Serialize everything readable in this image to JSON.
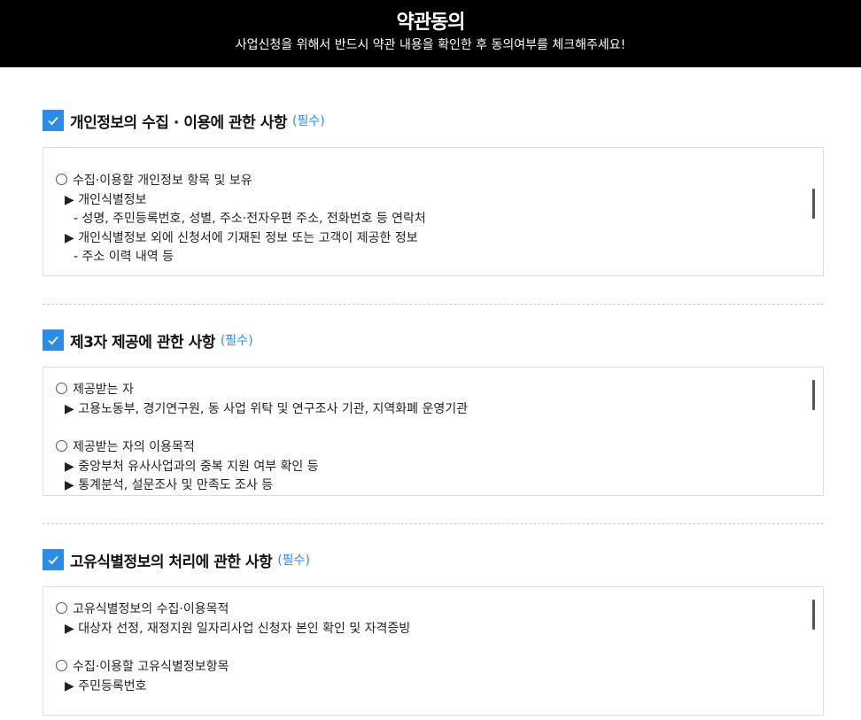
{
  "header": {
    "title": "약관동의",
    "subtitle": "사업신청을 위해서 반드시 약관 내용을 확인한 후 동의여부를 체크해주세요!"
  },
  "sections": [
    {
      "title": "개인정보의 수집 · 이용에 관한 사항",
      "required": "(필수)",
      "checked": true,
      "lines": [
        "수집·이용할 개인정보 항목 및 보유",
        "▶ 개인식별정보",
        "- 성명, 주민등록번호, 성별, 주소·전자우편 주소, 전화번호 등 연락처",
        "▶ 개인식별정보 외에 신청서에 기재된 정보 또는 고객이 제공한 정보",
        "- 주소 이력 내역 등"
      ]
    },
    {
      "title": "제3자 제공에 관한 사항",
      "required": "(필수)",
      "checked": true,
      "lines": [
        "제공받는 자",
        "▶ 고용노동부, 경기연구원, 동 사업 위탁 및 연구조사 기관, 지역화폐 운영기관",
        "제공받는 자의 이용목적",
        "▶ 중앙부처 유사사업과의 중복 지원 여부 확인 등",
        "▶ 통계분석, 설문조사 및 만족도 조사 등"
      ]
    },
    {
      "title": "고유식별정보의 처리에 관한 사항",
      "required": "(필수)",
      "checked": true,
      "lines": [
        "고유식별정보의 수집·이용목적",
        "▶ 대상자 선정, 재정지원 일자리사업 신청자 본인 확인 및 자격증빙",
        "수집·이용할 고유식별정보항목",
        "▶ 주민등록번호"
      ]
    }
  ],
  "colors": {
    "accent": "#2b8ce8",
    "header_bg": "#000000"
  },
  "icons": {
    "checkbox": "checkmark-icon",
    "scrollbar": "scrollbar-thumb"
  }
}
